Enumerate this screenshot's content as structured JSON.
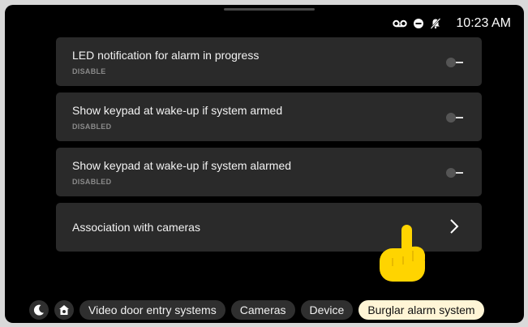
{
  "statusbar": {
    "time": "10:23 AM",
    "icons": [
      "voicemail-icon",
      "do-not-disturb-icon",
      "notifications-off-icon"
    ]
  },
  "settings": [
    {
      "title": "LED notification for alarm in progress",
      "subtitle": "DISABLE",
      "control": "toggle",
      "state": "off"
    },
    {
      "title": "Show keypad at wake-up if system armed",
      "subtitle": "DISABLED",
      "control": "toggle",
      "state": "off"
    },
    {
      "title": "Show keypad at wake-up if system alarmed",
      "subtitle": "DISABLED",
      "control": "toggle",
      "state": "off"
    },
    {
      "title": "Association with cameras",
      "control": "chevron-right-icon"
    }
  ],
  "cursor": "pointing-hand-icon",
  "nav": {
    "icons": [
      "moon-icon",
      "home-settings-icon"
    ],
    "tabs": [
      {
        "label": "Video door entry systems",
        "active": false
      },
      {
        "label": "Cameras",
        "active": false
      },
      {
        "label": "Device",
        "active": false
      },
      {
        "label": "Burglar alarm system",
        "active": true
      }
    ]
  },
  "colors": {
    "active_tab": "#fff5d6",
    "card": "#2a2a2a",
    "background": "#000000",
    "cursor": "#ffd400"
  }
}
